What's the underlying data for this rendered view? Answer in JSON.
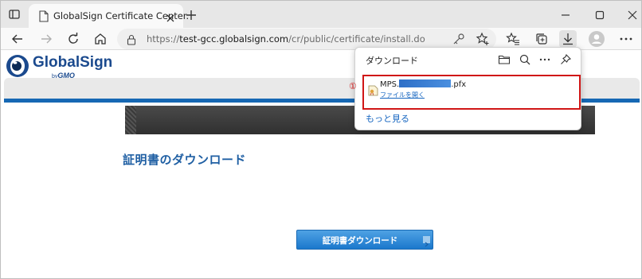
{
  "browser": {
    "tab_title": "GlobalSign Certificate Center.",
    "url_prefix": "https://",
    "url_host": "test-gcc.globalsign.com",
    "url_path": "/cr/public/certificate/install.do"
  },
  "page": {
    "logo_name": "GlobalSign",
    "logo_by": "by",
    "logo_gmo": "GMO",
    "title": "証明書のダウンロード",
    "download_button": "証明書ダウンロード"
  },
  "downloads": {
    "title": "ダウンロード",
    "item_marker": "①",
    "item_name_prefix": "MPS.",
    "item_name_suffix": ".pfx",
    "item_open_link": "ファイルを開く",
    "see_more": "もっと見る"
  },
  "colors": {
    "brand_blue": "#1b4a8e",
    "highlight_red": "#d01616",
    "link_blue": "#1565c0"
  },
  "icons": {
    "tab_actions": "tab-actions-icon",
    "page": "page-icon",
    "close": "close-icon",
    "new_tab": "plus-icon",
    "minimize": "minimize-icon",
    "maximize": "maximize-icon",
    "back": "back-arrow-icon",
    "forward": "forward-arrow-icon",
    "refresh": "refresh-icon",
    "home": "home-icon",
    "lock": "lock-icon",
    "key": "key-icon",
    "favorite_add": "star-plus-icon",
    "favorites": "favorites-icon",
    "collections": "collections-icon",
    "download": "download-icon",
    "profile": "profile-icon",
    "folder": "folder-icon",
    "search": "search-icon",
    "more": "more-icon",
    "pin": "pin-icon",
    "certificate_file": "certificate-file-icon"
  }
}
